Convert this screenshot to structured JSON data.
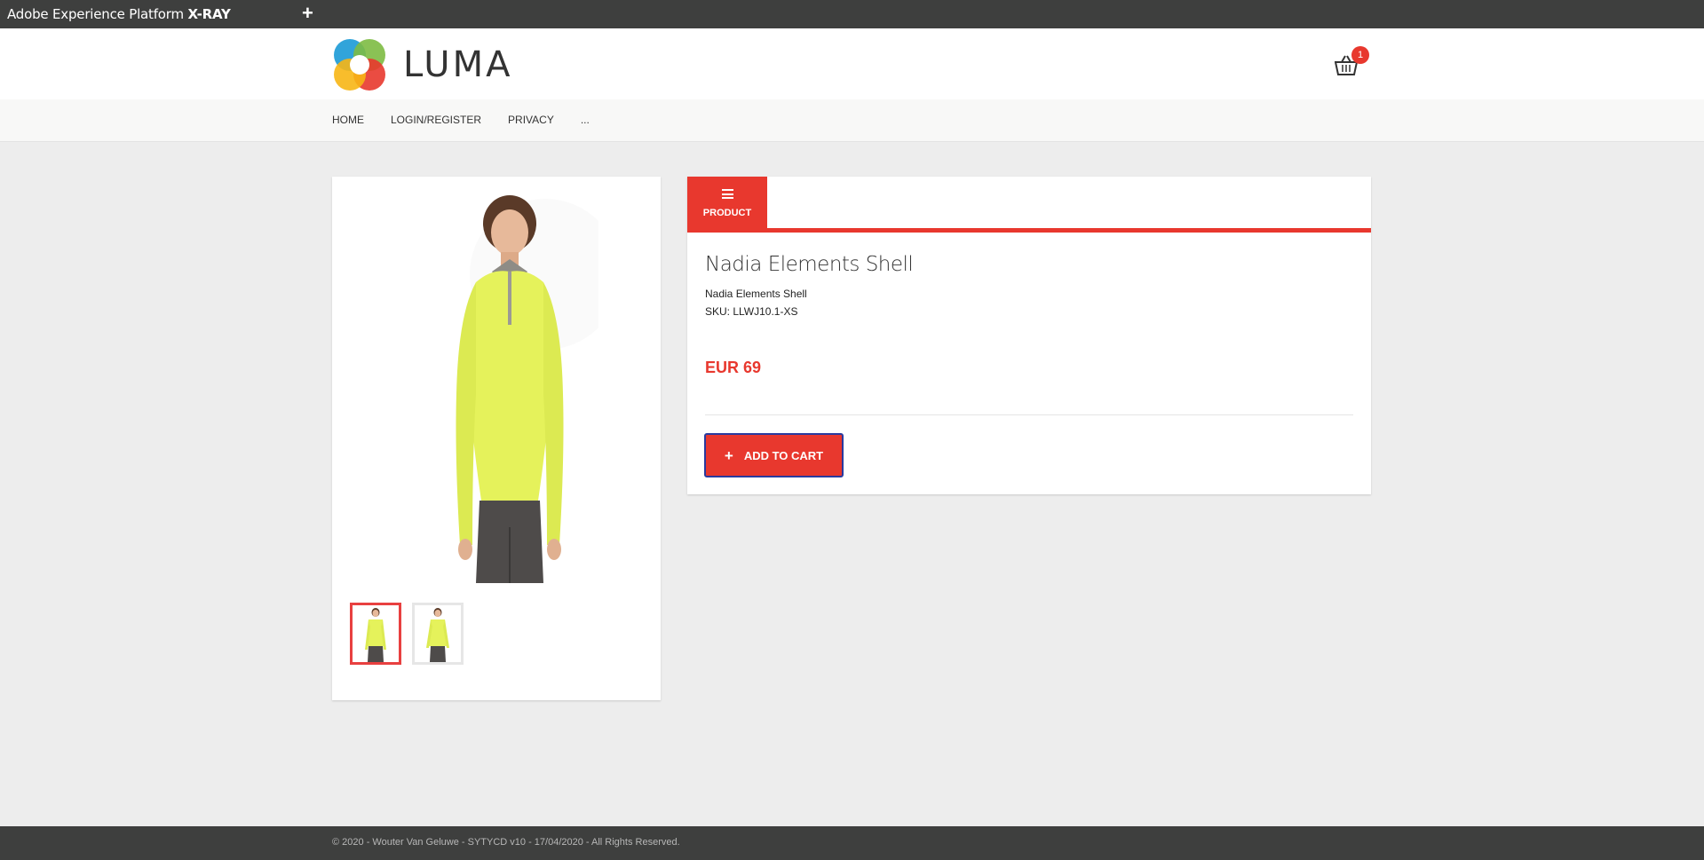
{
  "xray": {
    "title_prefix": "Adobe Experience Platform ",
    "title_bold": "X-RAY",
    "add_label": "+"
  },
  "header": {
    "logo_text": "LUMA",
    "cart_count": "1",
    "cart_icon": "basket-icon"
  },
  "nav": {
    "items": [
      {
        "label": "HOME"
      },
      {
        "label": "LOGIN/REGISTER"
      },
      {
        "label": "PRIVACY"
      },
      {
        "label": "..."
      }
    ]
  },
  "gallery": {
    "thumbnails_count": 2,
    "active_thumbnail": 0
  },
  "product": {
    "tab_label": "PRODUCT",
    "tab_icon": "menu-icon",
    "title": "Nadia Elements Shell",
    "name": "Nadia Elements Shell",
    "sku": "SKU: LLWJ10.1-XS",
    "price": "EUR 69",
    "add_to_cart_label": "ADD TO CART",
    "add_to_cart_icon": "plus-icon"
  },
  "footer": {
    "text": "© 2020 - Wouter Van Geluwe - SYTYCD v10 - 17/04/2020 - All Rights Reserved."
  },
  "colors": {
    "accent": "#e8382e",
    "dark_bar": "#3e3f3e",
    "page_bg": "#ededed",
    "button_border": "#2a3a9e"
  }
}
